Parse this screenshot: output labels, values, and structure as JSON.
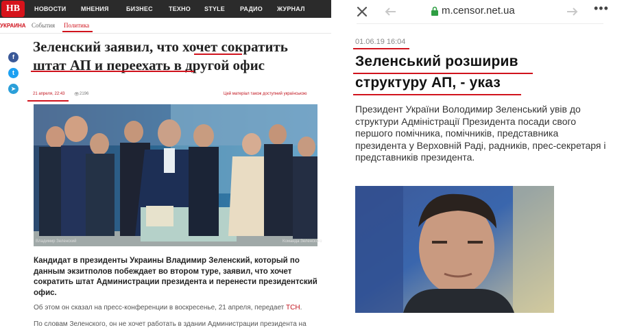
{
  "left_site": {
    "logo": "НВ",
    "nav": [
      "НОВОСТИ",
      "МНЕНИЯ",
      "БИЗНЕС",
      "ТЕХНО",
      "STYLE",
      "РАДИО",
      "ЖУРНАЛ"
    ],
    "subnav": {
      "section": "УКРАИНА",
      "tabs": [
        "События",
        "Политика"
      ]
    },
    "social": [
      "f",
      "t",
      "➤"
    ],
    "headline": "Зеленский заявил, что хочет сократить штат АП и переехать в другой офис",
    "date": "21 апреля, 22:43",
    "views": "2196",
    "notice": "Цей матеріал також доступний українською",
    "photo_caption_left": "Владимир Зеленский",
    "photo_caption_right": "Команда Зеленского",
    "lede": "Кандидат в президенты Украины Владимир Зеленский, который по данным экзитполов побеждает во втором туре, заявил, что хочет сократить штат Администрации президента и перенести президентский офис.",
    "para1_text": "Об этом он сказал на пресс-конференции в воскресенье, 21 апреля, передает ",
    "para1_link": "ТСН",
    "para1_end": ".",
    "para2": "По словам Зеленского, он не хочет работать в здании Администрации президента на"
  },
  "right_site": {
    "url": "m.censor.net.ua",
    "date": "01.06.19 16:04",
    "headline_line1": "Зеленський розширив",
    "headline_line2": "структуру АП, - указ",
    "body": "Президент України Володимир Зеленський увів до структури Адміністрації Президента посади свого першого помічника, помічників, представника президента у Верховній Раді, радників, прес-секретаря і представників президента."
  },
  "colors": {
    "accent_red": "#d0121c",
    "nav_bg": "#2b2b2b",
    "lock_green": "#2e9e43"
  }
}
